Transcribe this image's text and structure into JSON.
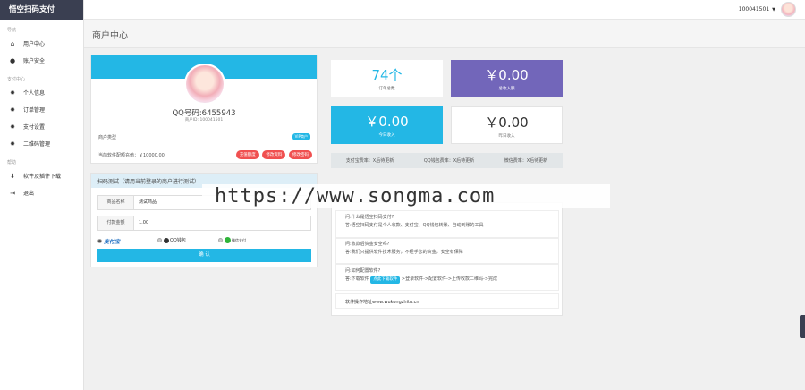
{
  "brand": "悟空扫码支付",
  "sidebar": {
    "section_nav": "导航",
    "items_nav": [
      {
        "label": "用户中心",
        "icon": "home-icon"
      },
      {
        "label": "账户安全",
        "icon": "user-icon"
      }
    ],
    "section_pay": "支付中心",
    "items_pay": [
      {
        "label": "个人信息",
        "icon": "gear-icon"
      },
      {
        "label": "订单管理",
        "icon": "gear-icon"
      },
      {
        "label": "支付设置",
        "icon": "gear-icon"
      },
      {
        "label": "二维码管理",
        "icon": "gear-icon"
      }
    ],
    "section_help": "帮助",
    "items_help": [
      {
        "label": "软件及插件下载",
        "icon": "download-icon"
      },
      {
        "label": "退出",
        "icon": "logout-icon"
      }
    ]
  },
  "header": {
    "user_id": "100041501"
  },
  "page_title": "商户中心",
  "profile": {
    "qq": "QQ号码:6455943",
    "uid": "商户ID: 100041501",
    "merchant_label": "商户类型",
    "merchant_tag": "VIP商户",
    "balance": "当前软件配额充值：￥10000.00",
    "buttons": [
      "充值额度",
      "修改资料",
      "修改密码"
    ]
  },
  "test_pay": {
    "title": "扫码测试（请用当前登录的商户进行测试）",
    "fields": [
      {
        "label": "商品名称",
        "value": "测试商品"
      },
      {
        "label": "付款金额",
        "value": "1.00"
      }
    ],
    "methods": [
      "支付宝",
      "QQ钱包",
      "微信支付"
    ],
    "confirm": "确 认"
  },
  "stats": [
    {
      "value": "74个",
      "label": "订单总数"
    },
    {
      "value": "￥0.00",
      "label": "总收入额"
    },
    {
      "value": "￥0.00",
      "label": "今日收入"
    },
    {
      "value": "￥0.00",
      "label": "昨日收入"
    }
  ],
  "rates": [
    "支付宝费率：X后待更新",
    "QQ钱包费率：X后待更新",
    "微信费率：X后待更新"
  ],
  "faq": [
    {
      "q": "问:什么是悟空扫码支付?",
      "a": "答:悟空扫码支付是个人收款、支付宝、QQ钱包转账、自动到账的工具"
    },
    {
      "q": "问:收款后资金安全吗?",
      "a": "答:我们只提供软件技术服务，不经手您的资金，安全有保障"
    },
    {
      "q": "问:如何配置软件?",
      "a_pre": "答:下载软件",
      "btn": "点此下载软件",
      "a_post": ">登录软件->配置软件->上传收款二维码->完成"
    }
  ],
  "faq_foot": "软件操作地址www.wukongzhitu.cn",
  "watermark": "https://www.songma.com"
}
